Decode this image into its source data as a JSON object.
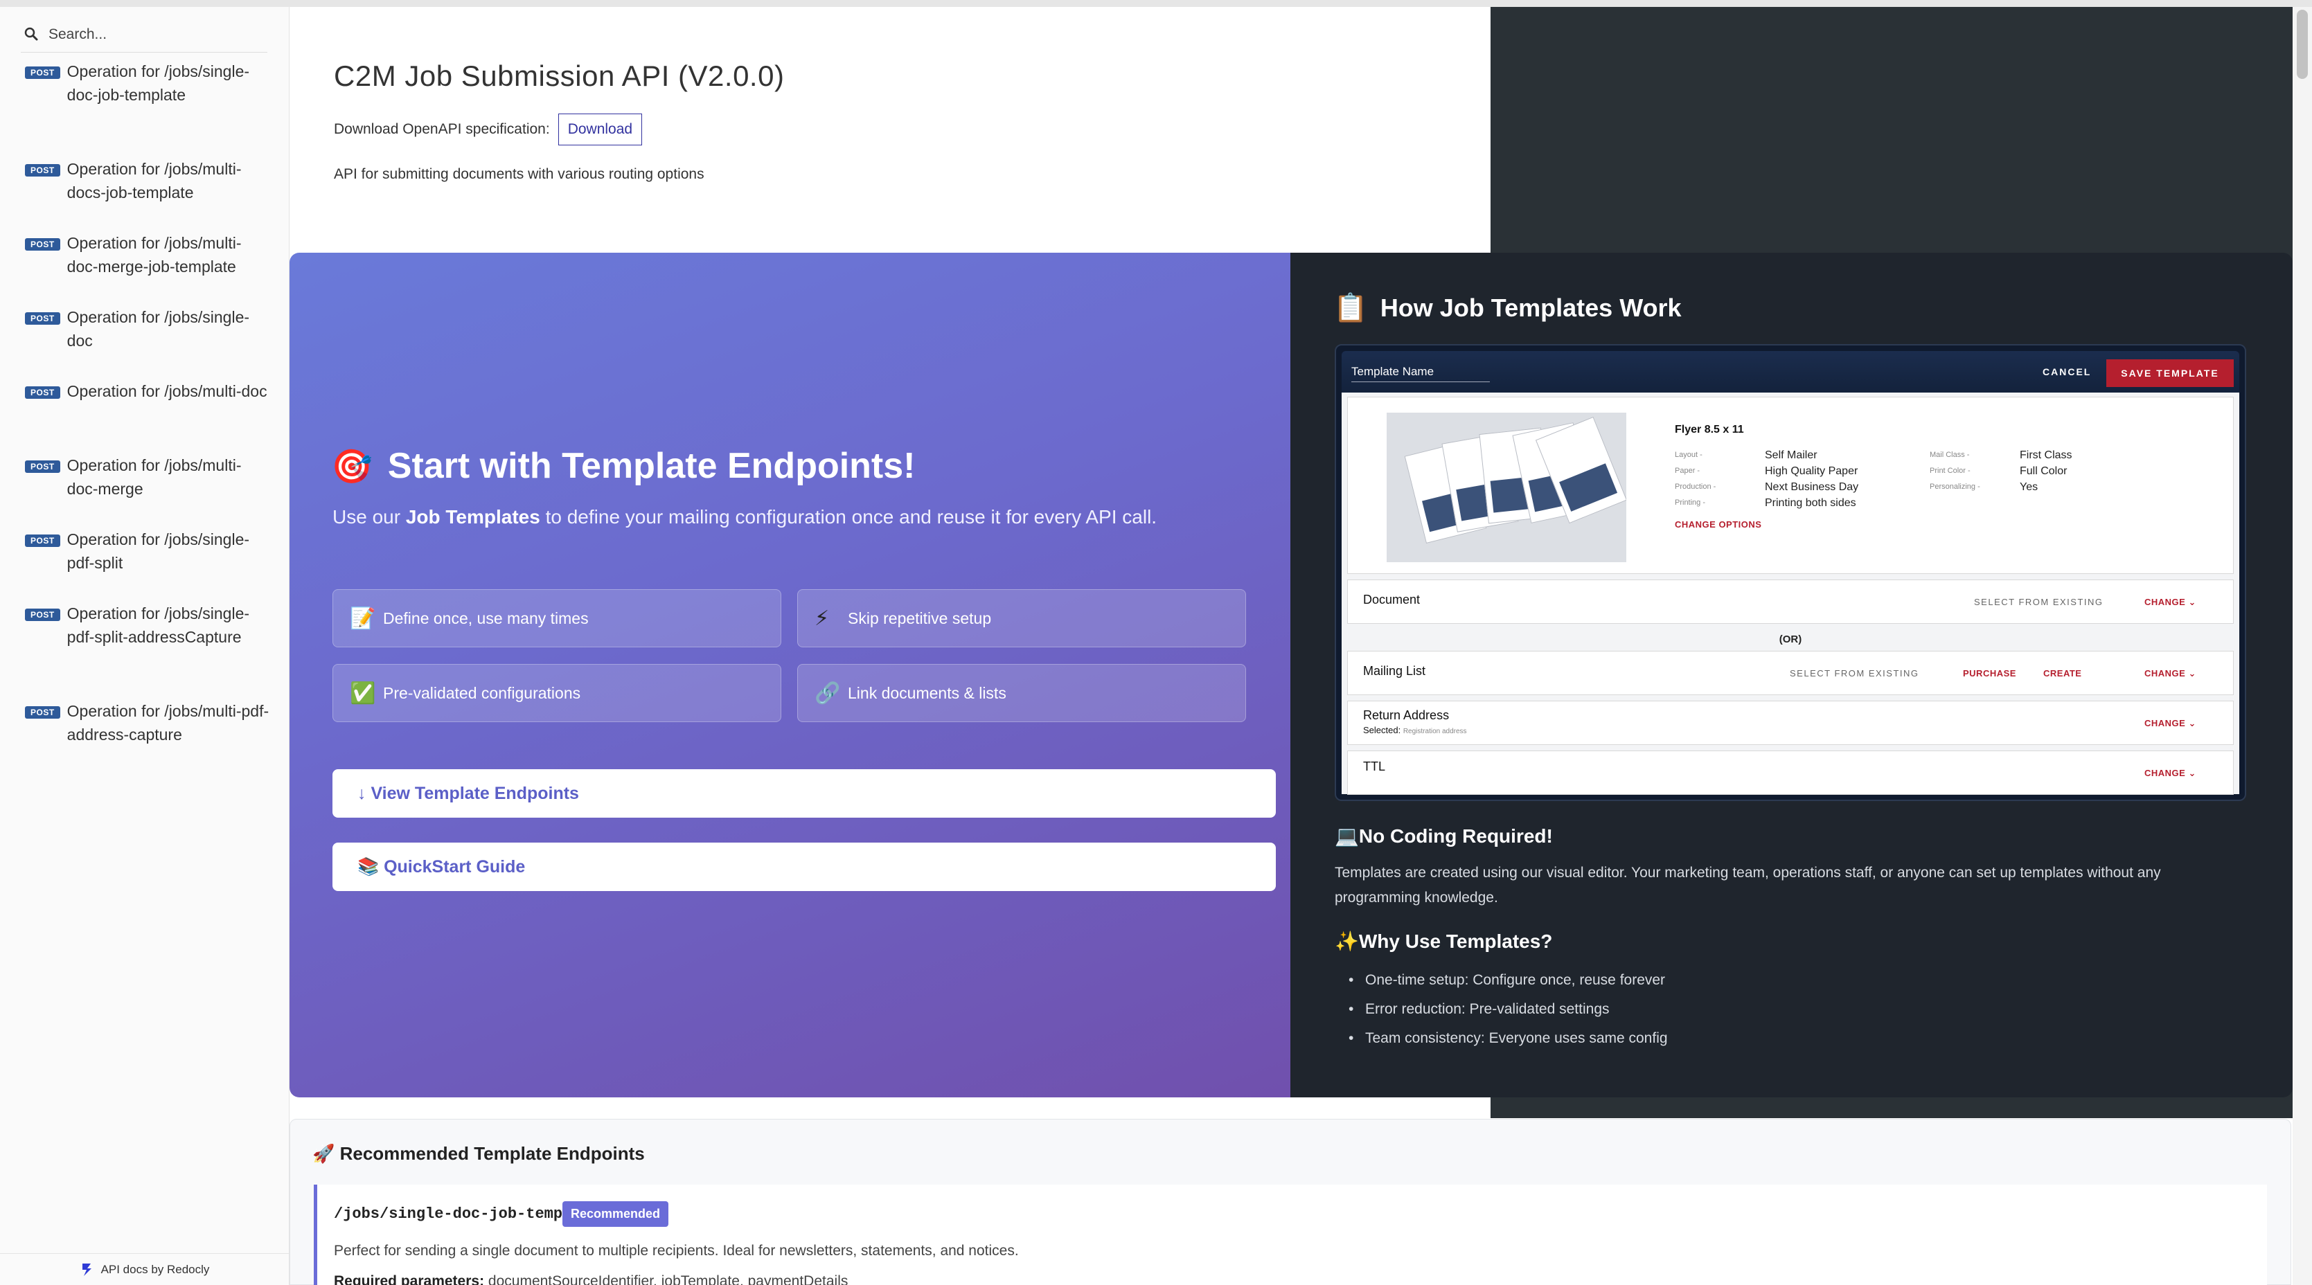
{
  "sidebar": {
    "search_placeholder": "Search...",
    "items": [
      {
        "method": "POST",
        "label": "Operation for /jobs/single-doc-job-template"
      },
      {
        "method": "POST",
        "label": "Operation for /jobs/multi-docs-job-template"
      },
      {
        "method": "POST",
        "label": "Operation for /jobs/multi-doc-merge-job-template"
      },
      {
        "method": "POST",
        "label": "Operation for /jobs/single-doc"
      },
      {
        "method": "POST",
        "label": "Operation for /jobs/multi-doc"
      },
      {
        "method": "POST",
        "label": "Operation for /jobs/multi-doc-merge"
      },
      {
        "method": "POST",
        "label": "Operation for /jobs/single-pdf-split"
      },
      {
        "method": "POST",
        "label": "Operation for /jobs/single-pdf-split-addressCapture"
      },
      {
        "method": "POST",
        "label": "Operation for /jobs/multi-pdf-address-capture"
      }
    ],
    "footer": "API docs by Redocly"
  },
  "header": {
    "title": "C2M Job Submission API (V2.0.0)",
    "download_label": "Download OpenAPI specification:",
    "download_button": "Download",
    "description": "API for submitting documents with various routing options"
  },
  "hero": {
    "icon": "🎯",
    "title": "Start with Template Endpoints!",
    "subtitle_pre": "Use our ",
    "subtitle_bold": "Job Templates",
    "subtitle_post": " to define your mailing configuration once and reuse it for every API call.",
    "features": [
      {
        "icon": "📝",
        "text": "Define once, use many times"
      },
      {
        "icon": "⚡",
        "text": "Skip repetitive setup"
      },
      {
        "icon": "✅",
        "text": "Pre-validated configurations"
      },
      {
        "icon": "🔗",
        "text": "Link documents & lists"
      }
    ],
    "view_button": "↓ View Template Endpoints",
    "quickstart_button": "📚 QuickStart Guide"
  },
  "how": {
    "icon": "📋",
    "title": "How Job Templates Work",
    "mock": {
      "template_name": "Template Name",
      "cancel": "CANCEL",
      "save": "SAVE TEMPLATE",
      "flyer_title": "Flyer 8.5 x 11",
      "left_keys": [
        "Layout -",
        "Paper -",
        "Production -",
        "Printing -"
      ],
      "left_vals": [
        "Self Mailer",
        "High Quality Paper",
        "Next Business Day",
        "Printing both sides"
      ],
      "right_keys": [
        "Mail Class -",
        "Print Color -",
        "Personalizing -"
      ],
      "right_vals": [
        "First Class",
        "Full Color",
        "Yes"
      ],
      "change_options": "CHANGE OPTIONS",
      "document": "Document",
      "select_existing": "SELECT FROM EXISTING",
      "change": "CHANGE ⌄",
      "or": "(OR)",
      "mailing_list": "Mailing List",
      "purchase": "PURCHASE",
      "create": "CREATE",
      "return_address": "Return Address",
      "selected": "Selected:",
      "selected_value": "Registration address",
      "ttl": "TTL"
    },
    "no_code_title": "💻No Coding Required!",
    "no_code_text": "Templates are created using our visual editor. Your marketing team, operations staff, or anyone can set up templates without any programming knowledge.",
    "why_title": "✨Why Use Templates?",
    "why_items": [
      "One-time setup: Configure once, reuse forever",
      "Error reduction: Pre-validated settings",
      "Team consistency: Everyone uses same config"
    ]
  },
  "recommended": {
    "title": "🚀 Recommended Template Endpoints",
    "path": "/jobs/single-doc-job-template",
    "badge": "Recommended",
    "description": "Perfect for sending a single document to multiple recipients. Ideal for newsletters, statements, and notices.",
    "params_label": "Required parameters:",
    "params_value": " documentSourceIdentifier, jobTemplate, paymentDetails"
  },
  "colors": {
    "accent": "#6a6cd8",
    "badge_post": "#2e5a9a",
    "dark_panel": "#2a3136",
    "hero_dark": "#1f252d",
    "save_red": "#b51f2e"
  }
}
